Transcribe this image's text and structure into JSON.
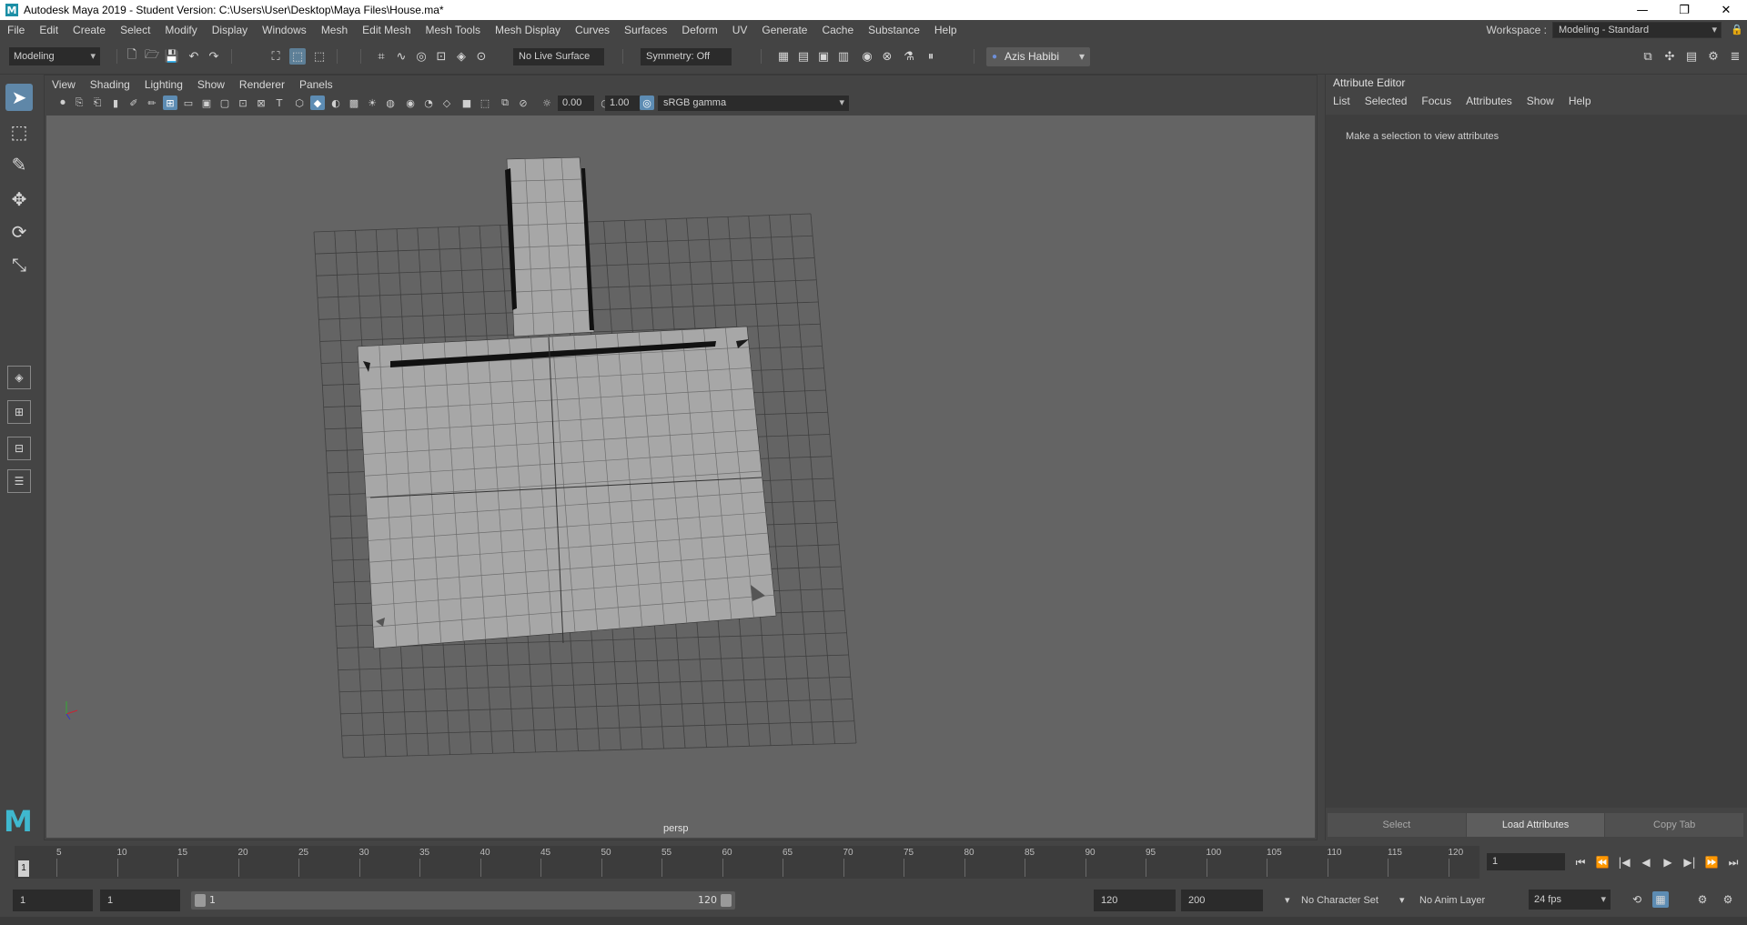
{
  "window": {
    "title": "Autodesk Maya 2019 - Student Version: C:\\Users\\User\\Desktop\\Maya Files\\House.ma*",
    "app_icon": "M",
    "controls": [
      "—",
      "❐",
      "✕"
    ]
  },
  "menubar": {
    "items": [
      "File",
      "Edit",
      "Create",
      "Select",
      "Modify",
      "Display",
      "Windows",
      "Mesh",
      "Edit Mesh",
      "Mesh Tools",
      "Mesh Display",
      "Curves",
      "Surfaces",
      "Deform",
      "UV",
      "Generate",
      "Cache",
      "Substance",
      "Help"
    ],
    "workspace_label": "Workspace :",
    "workspace_value": "Modeling - Standard"
  },
  "statusline": {
    "mode": "Modeling",
    "live_surface": "No Live Surface",
    "symmetry": "Symmetry: Off",
    "user": "Azis Habibi"
  },
  "panel": {
    "menu": [
      "View",
      "Shading",
      "Lighting",
      "Show",
      "Renderer",
      "Panels"
    ],
    "exposure": "0.00",
    "gamma": "1.00",
    "color_space": "sRGB gamma",
    "camera": "persp"
  },
  "attribute_editor": {
    "title": "Attribute Editor",
    "menu": [
      "List",
      "Selected",
      "Focus",
      "Attributes",
      "Show",
      "Help"
    ],
    "message": "Make a selection to view attributes",
    "buttons": [
      "Select",
      "Load Attributes",
      "Copy Tab"
    ]
  },
  "timeslider": {
    "ticks": [
      "5",
      "10",
      "15",
      "20",
      "25",
      "30",
      "35",
      "40",
      "45",
      "50",
      "55",
      "60",
      "65",
      "70",
      "75",
      "80",
      "85",
      "90",
      "95",
      "100",
      "105",
      "110",
      "115",
      "120"
    ],
    "current_frame": "1",
    "current_field": "1"
  },
  "rangeslider": {
    "start_field": "1",
    "playback_start": "1",
    "range_start": "1",
    "range_end": "120",
    "playback_end": "120",
    "end_field": "200",
    "character_set": "No Character Set",
    "anim_layer": "No Anim Layer",
    "fps": "24 fps"
  },
  "colors": {
    "viewport_bg": "#646464",
    "mesh_fill": "#a7a7a7",
    "accent": "#5d8cb3"
  }
}
